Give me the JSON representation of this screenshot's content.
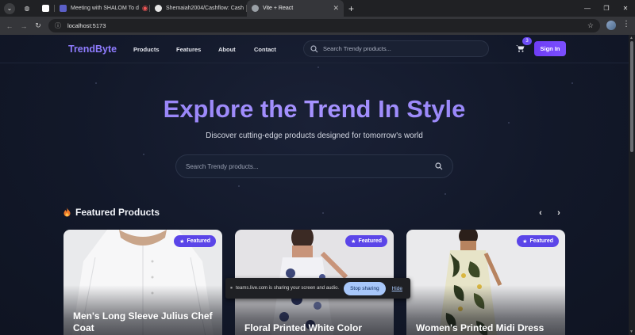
{
  "browser": {
    "tabs": [
      {
        "title": "",
        "color": "#1f1f1f"
      },
      {
        "title": "Meeting with SHALOM To d",
        "color": "#5b5fc7"
      },
      {
        "title": "Shemaiah2004/Cashflow: Cash",
        "color": "#e6e6e6"
      },
      {
        "title": "Vite + React",
        "color": "#9aa0a6"
      }
    ],
    "url": "localhost:5173"
  },
  "nav": {
    "logo": "TrendByte",
    "links": [
      "Products",
      "Features",
      "About",
      "Contact"
    ],
    "search_placeholder": "Search Trendy products...",
    "cart_count": "3",
    "signin": "Sign In"
  },
  "hero": {
    "title": "Explore the Trend In Style",
    "subtitle": "Discover cutting-edge products designed for tomorrow's world",
    "search_placeholder": "Search Trendy products..."
  },
  "featured": {
    "heading": "Featured Products",
    "badge": "Featured",
    "cards": [
      {
        "title": "Men's Long Sleeve Julius Chef Coat"
      },
      {
        "title": "Floral Printed White Color"
      },
      {
        "title": "Women's Printed Midi Dress"
      }
    ]
  },
  "share_bar": {
    "message": "teams.live.com is sharing your screen and audio.",
    "stop": "Stop sharing",
    "hide": "Hide"
  },
  "colors": {
    "accent": "#6c4cf5",
    "background": "#121829"
  }
}
